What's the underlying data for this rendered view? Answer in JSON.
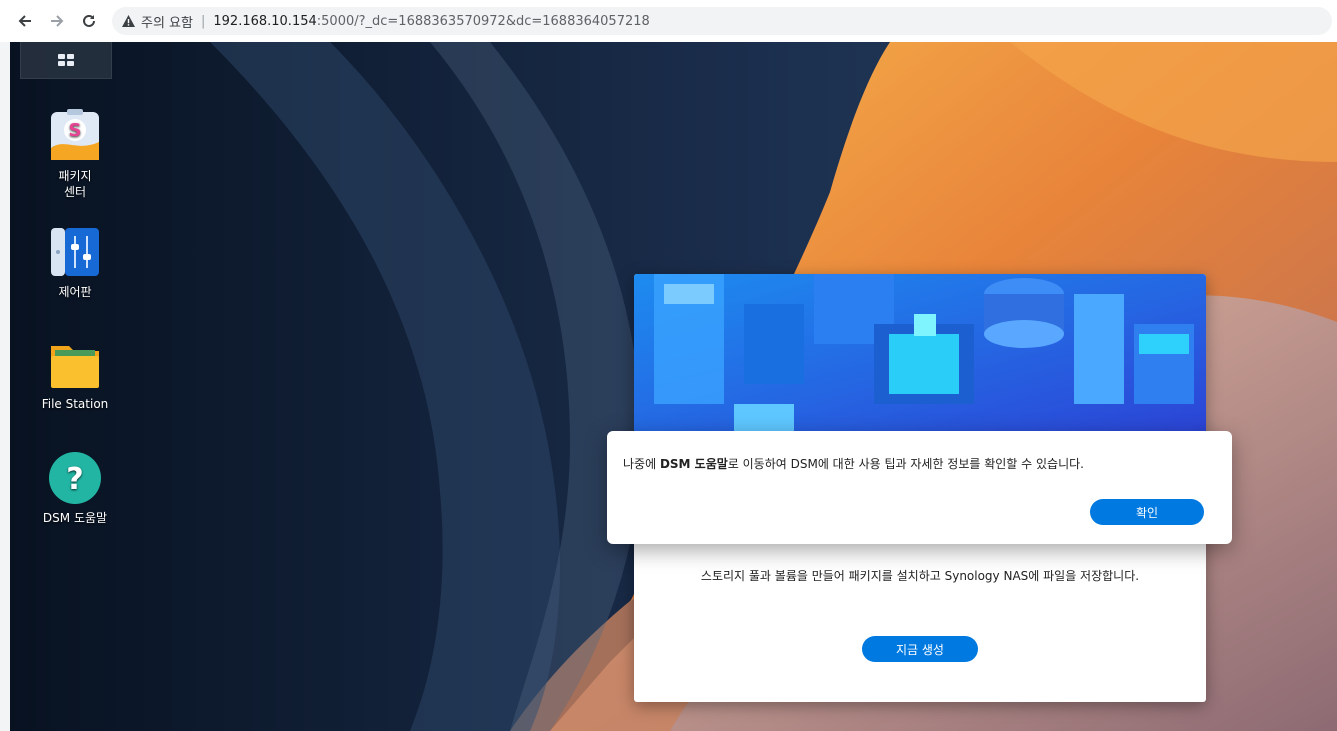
{
  "browser": {
    "warning_label": "주의 요함",
    "url_host": "192.168.10.154",
    "url_path": ":5000/?_dc=1688363570972&dc=1688364057218"
  },
  "desktop_icons": [
    {
      "label": "패키지\n센터",
      "icon": "package-center-icon"
    },
    {
      "label": "제어판",
      "icon": "control-panel-icon"
    },
    {
      "label": "File Station",
      "icon": "file-station-icon"
    },
    {
      "label": "DSM 도움말",
      "icon": "dsm-help-icon"
    }
  ],
  "welcome": {
    "description": "스토리지 풀과 볼륨을 만들어 패키지를 설치하고 Synology NAS에 파일을 저장합니다.",
    "create_button": "지금 생성"
  },
  "dialog": {
    "message_prefix": "나중에 ",
    "message_bold": "DSM 도움말",
    "message_suffix": "로 이동하여 DSM에 대한 사용 팁과 자세한 정보를 확인할 수 있습니다.",
    "ok_button": "확인"
  },
  "colors": {
    "accent": "#0079e0"
  }
}
